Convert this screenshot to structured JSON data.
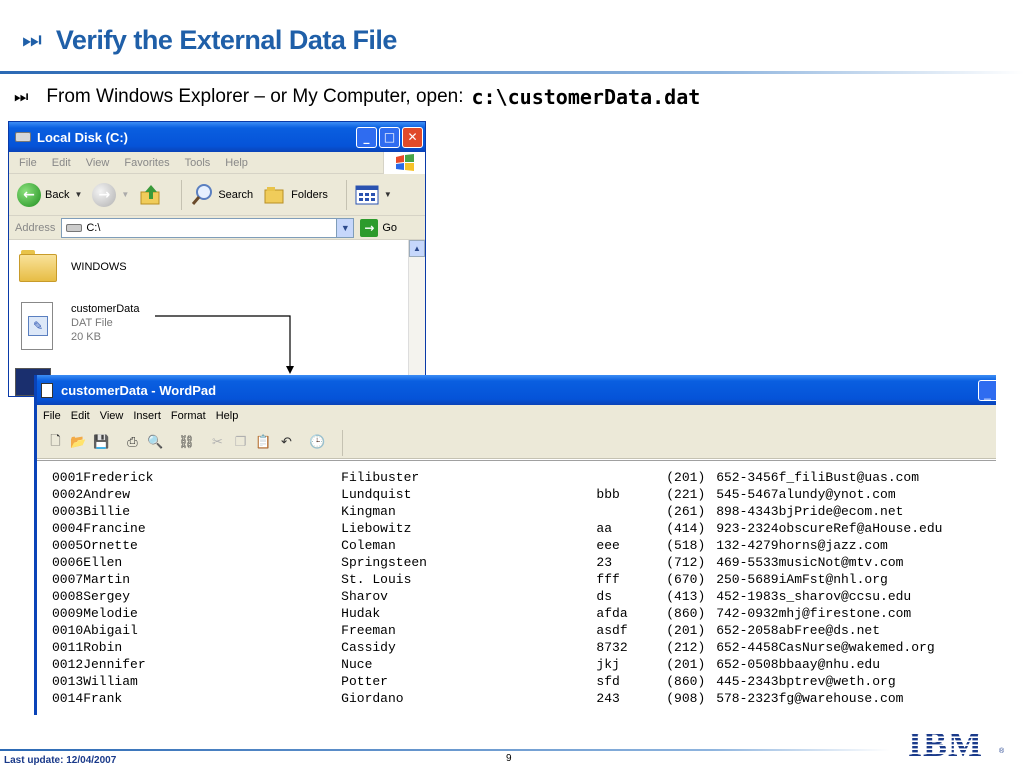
{
  "slide": {
    "title_bullet": "⏭",
    "title": "Verify the External Data File",
    "bullet_icon": "⏭",
    "bullet_text": "From Windows Explorer – or My Computer, open: ",
    "bullet_path": "c:\\customerData.dat"
  },
  "explorer": {
    "title": "Local Disk (C:)",
    "menu": [
      "File",
      "Edit",
      "View",
      "Favorites",
      "Tools",
      "Help"
    ],
    "toolbar": {
      "back": "Back",
      "search": "Search",
      "folders": "Folders"
    },
    "address_label": "Address",
    "address_value": "C:\\",
    "go": "Go",
    "items": [
      {
        "name": "WINDOWS"
      },
      {
        "name": "customerData",
        "type": "DAT File",
        "size": "20 KB"
      }
    ]
  },
  "wordpad": {
    "title": "customerData - WordPad",
    "menu": [
      "File",
      "Edit",
      "View",
      "Insert",
      "Format",
      "Help"
    ],
    "rows": [
      {
        "record": "0001Frederick",
        "last": "Filibuster",
        "code": "",
        "area": "(201)",
        "rest": "652-3456f_filiBust@uas.com"
      },
      {
        "record": "0002Andrew",
        "last": "Lundquist",
        "code": "bbb",
        "area": "(221)",
        "rest": "545-5467alundy@ynot.com"
      },
      {
        "record": "0003Billie",
        "last": "Kingman",
        "code": "",
        "area": "(261)",
        "rest": "898-4343bjPride@ecom.net"
      },
      {
        "record": "0004Francine",
        "last": "Liebowitz",
        "code": "aa",
        "area": "(414)",
        "rest": "923-2324obscureRef@aHouse.edu"
      },
      {
        "record": "0005Ornette",
        "last": "Coleman",
        "code": "eee",
        "area": "(518)",
        "rest": "132-4279horns@jazz.com"
      },
      {
        "record": "0006Ellen",
        "last": "Springsteen",
        "code": "23",
        "area": "(712)",
        "rest": "469-5533musicNot@mtv.com"
      },
      {
        "record": "0007Martin",
        "last": "St. Louis",
        "code": "fff",
        "area": "(670)",
        "rest": "250-5689iAmFst@nhl.org"
      },
      {
        "record": "0008Sergey",
        "last": "Sharov",
        "code": "ds",
        "area": "(413)",
        "rest": "452-1983s_sharov@ccsu.edu"
      },
      {
        "record": "0009Melodie",
        "last": "Hudak",
        "code": "afda",
        "area": "(860)",
        "rest": "742-0932mhj@firestone.com"
      },
      {
        "record": "0010Abigail",
        "last": "Freeman",
        "code": "asdf",
        "area": "(201)",
        "rest": "652-2058abFree@ds.net"
      },
      {
        "record": "0011Robin",
        "last": "Cassidy",
        "code": "8732",
        "area": "(212)",
        "rest": "652-4458CasNurse@wakemed.org"
      },
      {
        "record": "0012Jennifer",
        "last": "Nuce",
        "code": "jkj",
        "area": "(201)",
        "rest": "652-0508bbaay@nhu.edu"
      },
      {
        "record": "0013William",
        "last": "Potter",
        "code": "sfd",
        "area": "(860)",
        "rest": "445-2343bptrev@weth.org"
      },
      {
        "record": "0014Frank",
        "last": "Giordano",
        "code": "243",
        "area": "(908)",
        "rest": "578-2323fg@warehouse.com"
      }
    ]
  },
  "footer": {
    "last_update": "Last update: 12/04/2007",
    "page_number": "9",
    "logo": "IBM",
    "registered": "®"
  },
  "colors": {
    "title_blue": "#1f5fa8",
    "xp_titlebar": "#0553d8",
    "xp_face": "#ece9d8"
  },
  "icons": {
    "explorer": [
      "drive-icon",
      "minimize-icon",
      "maximize-icon",
      "close-icon",
      "windows-logo-icon",
      "back-icon",
      "forward-icon",
      "up-folder-icon",
      "search-icon",
      "folders-icon",
      "views-icon",
      "go-icon",
      "folder-icon",
      "dat-file-icon"
    ],
    "wordpad": [
      "new-icon",
      "open-icon",
      "save-icon",
      "print-icon",
      "print-preview-icon",
      "find-icon",
      "cut-icon",
      "copy-icon",
      "paste-icon",
      "undo-icon",
      "insert-datetime-icon"
    ]
  }
}
